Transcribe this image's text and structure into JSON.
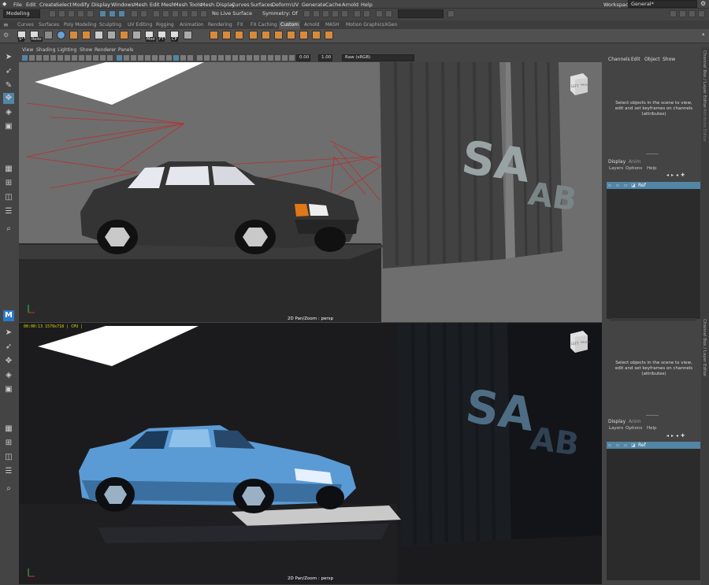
{
  "menubar": {
    "items": [
      "File",
      "Edit",
      "Create",
      "Select",
      "Modify",
      "Display",
      "Windows",
      "Mesh",
      "Edit Mesh",
      "Mesh Tools",
      "Mesh Display",
      "Curves",
      "Surfaces",
      "Deform",
      "UV",
      "Generate",
      "Cache",
      "Arnold",
      "Help"
    ],
    "workspace_label": "Workspace:",
    "workspace_value": "General*"
  },
  "statusline": {
    "mode": "Modeling",
    "live_surface": "No Live Surface",
    "symmetry": "Symmetry: Off"
  },
  "shelf": {
    "tabs": [
      "Curves",
      "Surfaces",
      "Poly Modeling",
      "Sculpting",
      "UV Editing",
      "Rigging",
      "Animation",
      "Rendering",
      "FX",
      "FX Caching",
      "Custom",
      "Arnold",
      "MASH",
      "Motion Graphics",
      "XGen"
    ],
    "active_tab": "Custom",
    "icon_labels": [
      "S*",
      "Redo",
      "Mod",
      "FT",
      "CP"
    ]
  },
  "viewport_top": {
    "menu": [
      "View",
      "Shading",
      "Lighting",
      "Show",
      "Renderer",
      "Panels"
    ],
    "field1": "0.00",
    "field2": "1.00",
    "colorspace": "Raw (sRGB)",
    "caption": "2D Pan/Zoom : persp",
    "cube_left": "LEFT",
    "cube_front": "FRONT"
  },
  "viewport_bottom": {
    "hud": "00:00:13  1579x718 | CPU |",
    "caption": "2D Pan/Zoom : persp",
    "cube_left": "LEFT",
    "cube_front": "FRONT"
  },
  "channel_box": {
    "menu": [
      "Channels",
      "Edit",
      "Object",
      "Show"
    ],
    "message": "Select objects in the scene to view, edit and set keyframes on channels (attributes)"
  },
  "layer_editor_top": {
    "tabs": [
      "Display",
      "Anim"
    ],
    "menu": [
      "Layers",
      "Options",
      "Help"
    ],
    "layer_name": "Ref"
  },
  "channel_box_bottom": {
    "message": "Select objects in the scene to view, edit and set keyframes on channels (attributes)"
  },
  "layer_editor_bottom": {
    "tabs": [
      "Display",
      "Anim"
    ],
    "menu": [
      "Layers",
      "Options",
      "Help"
    ],
    "layer_name": "Ref"
  },
  "side_tabs": [
    "Channel Box / Layer Editor",
    "Attribute Editor",
    "Channel Box / Layer Editor"
  ],
  "scene_text": {
    "sign1": "SA",
    "sign2": "AB"
  },
  "colors": {
    "accent": "#5285a6",
    "car_top": "#3a3a3a",
    "car_bottom": "#5b9bd5",
    "floor_bottom": "#1e1e22",
    "hud": "#dddd00"
  }
}
